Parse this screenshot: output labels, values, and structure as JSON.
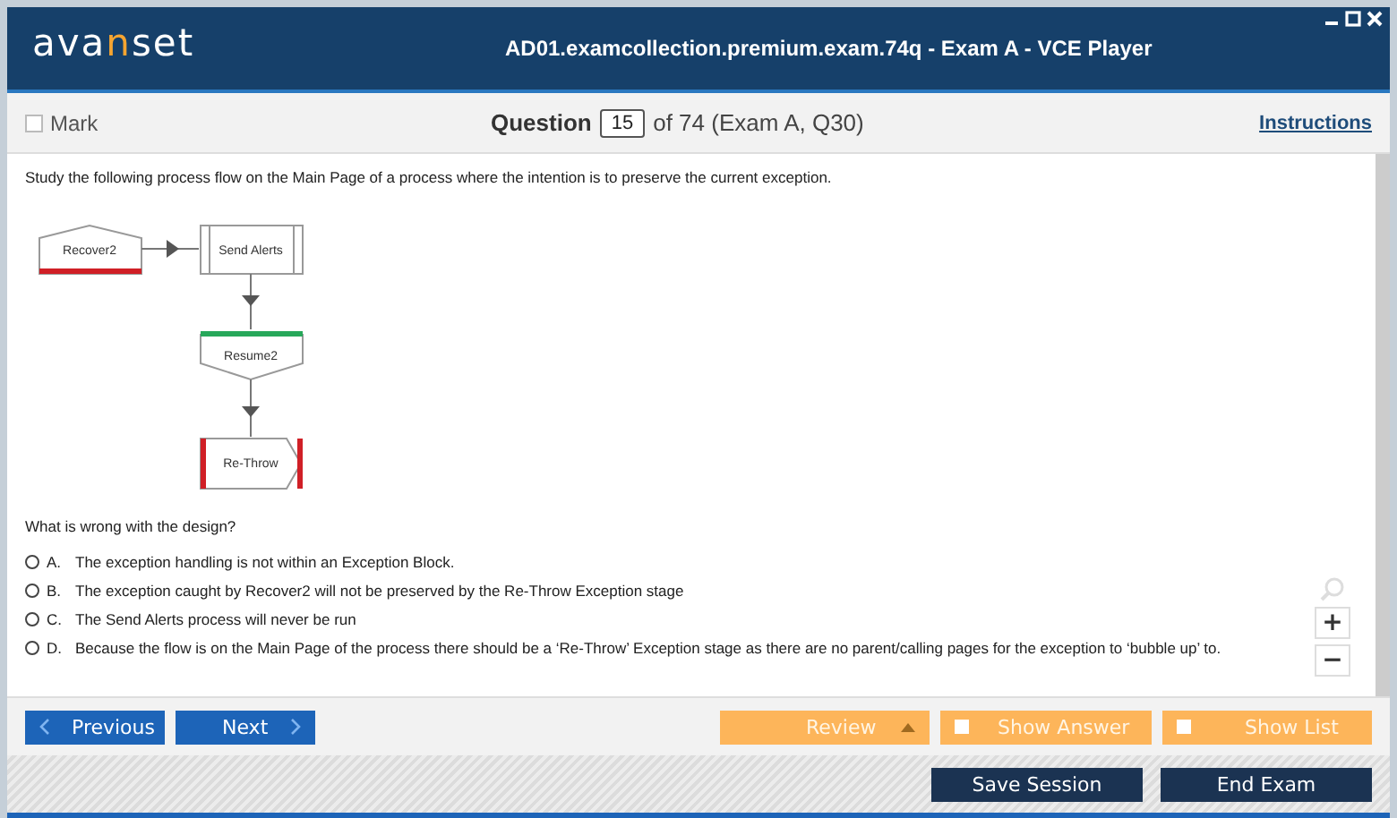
{
  "window": {
    "logo": [
      {
        "text": "ava",
        "accent": false
      },
      {
        "text": "n",
        "accent": true
      },
      {
        "text": "set",
        "accent": false
      }
    ],
    "title": "AD01.examcollection.premium.exam.74q - Exam A - VCE Player"
  },
  "toolbar": {
    "mark": {
      "label": "Mark",
      "checked": false
    },
    "question_label": "Question",
    "question_number": "15",
    "question_of": "of 74 (Exam A, Q30)",
    "instructions": "Instructions"
  },
  "question": {
    "text": "Study the following process flow on the Main Page of a process where the intention is to preserve the current exception.",
    "diagram": [
      {
        "kind": "recover",
        "label": "Recover2"
      },
      {
        "kind": "process",
        "label": "Send Alerts"
      },
      {
        "kind": "resume",
        "label": "Resume2"
      },
      {
        "kind": "exception",
        "label": "Re-Throw"
      }
    ],
    "prompt": "What is wrong with the design?",
    "answers": [
      {
        "letter": "A.",
        "text": "The exception handling is not within an Exception Block.",
        "selected": false
      },
      {
        "letter": "B.",
        "text": "The exception caught by Recover2 will not be preserved by the Re-Throw Exception stage",
        "selected": false
      },
      {
        "letter": "C.",
        "text": "The Send Alerts process will never be run",
        "selected": false
      },
      {
        "letter": "D.",
        "text": "Because the flow is on the Main Page of the process there should be a ‘Re-Throw’ Exception stage as there are no parent/calling pages for the exception to ‘bubble up’ to.",
        "selected": false
      }
    ],
    "zoom": [
      "+",
      "−"
    ]
  },
  "nav": {
    "previous": "Previous",
    "next": "Next",
    "review": "Review",
    "show_answer": {
      "label": "Show Answer",
      "checked": false
    },
    "show_list": {
      "label": "Show List",
      "checked": false
    }
  },
  "session": {
    "save": "Save Session",
    "end": "End Exam"
  }
}
